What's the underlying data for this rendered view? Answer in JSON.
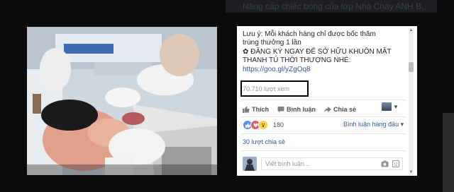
{
  "background": {
    "top_strip_text": "Nâng cấp chiếc bóng của lớp Nhà Chay ANH B..."
  },
  "post": {
    "caption_lines": [
      "Lưu ý: Mỗi khách hàng chỉ được bốc thăm",
      "trúng thưởng 1 lần",
      "✿ ĐĂNG KÝ NGAY ĐỂ SỞ HỮU KHUÔN MẶT",
      "THANH TÚ THỜI THƯỢNG NHÉ:"
    ],
    "link": "https://goo.gl/yZgOq8",
    "views": "70.710 lượt xem"
  },
  "actions": {
    "like": "Thích",
    "comment": "Bình luận",
    "share": "Chia sẻ"
  },
  "reactions": {
    "count": "180",
    "sort_label": "Bình luận hàng đầu",
    "sort_caret": "▾"
  },
  "shares": {
    "label": "30 lượt chia sẻ"
  },
  "comment_box": {
    "placeholder": "Viết bình luận..."
  },
  "colors": {
    "link": "#365899",
    "text": "#1d2129",
    "muted": "#90949c",
    "like": "#5890ff",
    "love": "#f25268",
    "wow": "#f7d148"
  }
}
